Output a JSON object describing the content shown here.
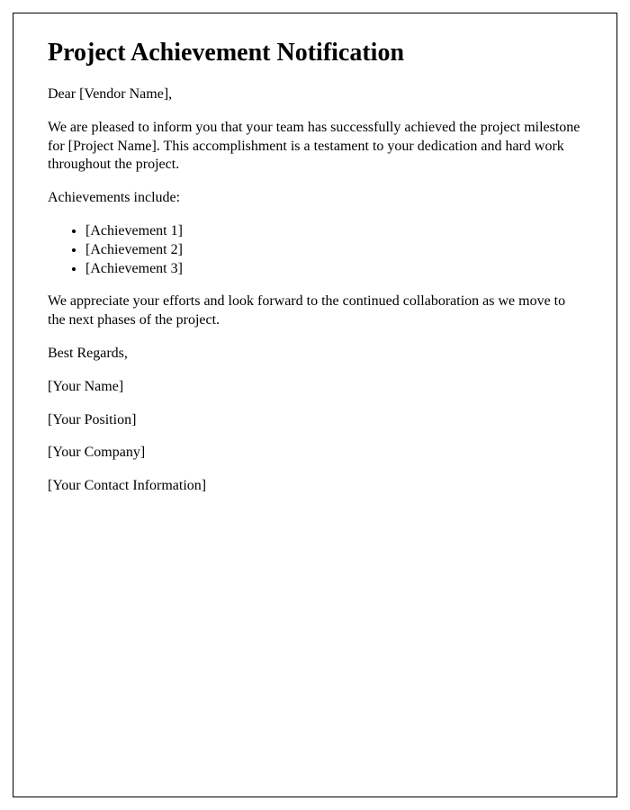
{
  "title": "Project Achievement Notification",
  "greeting": "Dear [Vendor Name],",
  "intro": "We are pleased to inform you that your team has successfully achieved the project milestone for [Project Name]. This accomplishment is a testament to your dedication and hard work throughout the project.",
  "achievements_label": "Achievements include:",
  "achievements": [
    "[Achievement 1]",
    "[Achievement 2]",
    "[Achievement 3]"
  ],
  "closing": "We appreciate your efforts and look forward to the continued collaboration as we move to the next phases of the project.",
  "signoff": "Best Regards,",
  "signature": {
    "name": "[Your Name]",
    "position": "[Your Position]",
    "company": "[Your Company]",
    "contact": "[Your Contact Information]"
  }
}
